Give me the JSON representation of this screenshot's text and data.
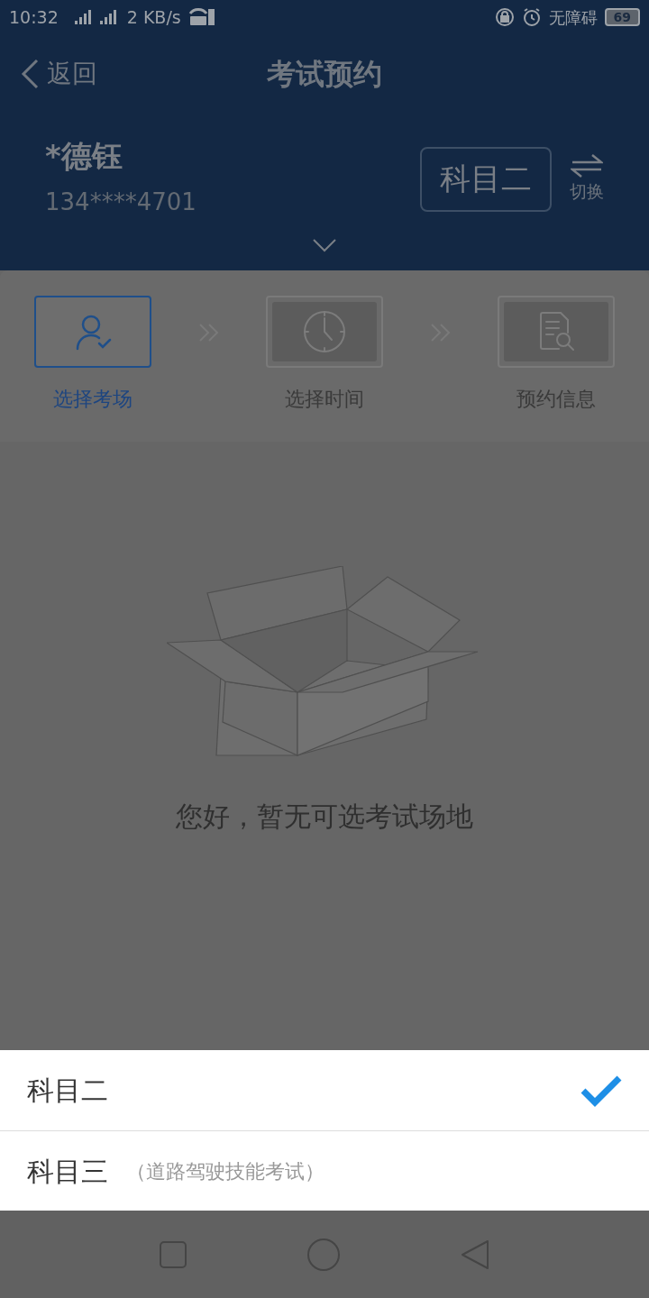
{
  "status_bar": {
    "time": "10:32",
    "network_speed": "2 KB/s",
    "accessibility": "无障碍",
    "battery": "69"
  },
  "nav": {
    "back": "返回",
    "title": "考试预约"
  },
  "user": {
    "name": "*德钰",
    "phone": "134****4701",
    "subject": "科目二",
    "switch": "切换"
  },
  "steps": [
    {
      "label": "选择考场",
      "kind": "person",
      "selected": true
    },
    {
      "label": "选择时间",
      "kind": "clock",
      "selected": false
    },
    {
      "label": "预约信息",
      "kind": "document",
      "selected": false
    }
  ],
  "empty_message": "您好，暂无可选考试场地",
  "sheet": [
    {
      "label": "科目二",
      "selected": true
    },
    {
      "label": "科目三",
      "note": "（道路驾驶技能考试）",
      "selected": false
    }
  ]
}
